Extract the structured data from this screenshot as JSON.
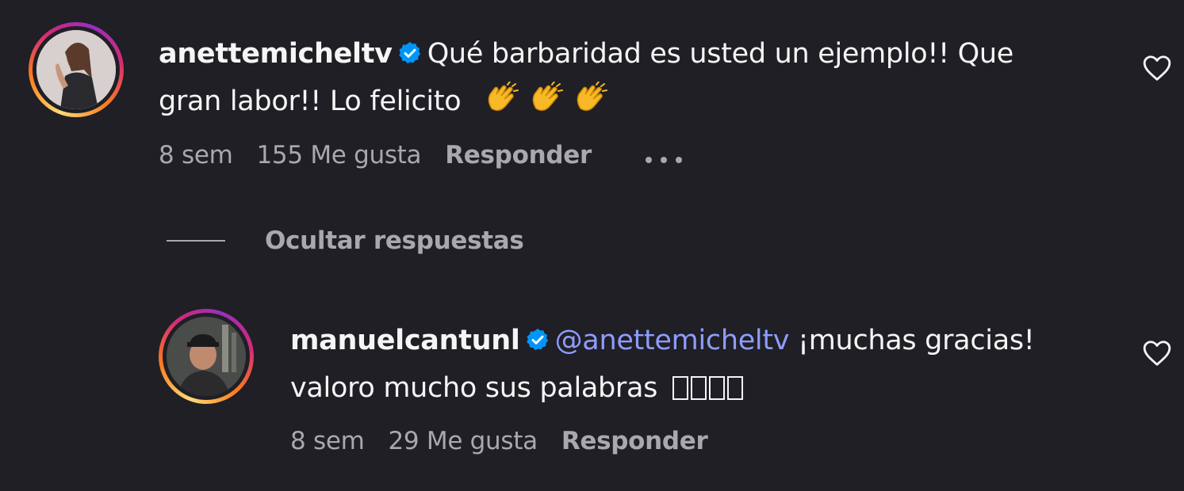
{
  "comments": [
    {
      "username": "anettemicheltv",
      "text_line1": "Qué barbaridad es usted un ejemplo!! Que",
      "text_line2": "gran labor!! Lo felicito",
      "time": "8 sem",
      "likes": "155 Me gusta",
      "reply_label": "Responder",
      "verified": true,
      "reaction_icons": [
        "clapping-hands-icon",
        "clapping-hands-icon",
        "clapping-hands-icon"
      ]
    },
    {
      "username": "manuelcantunl",
      "mention": "@anettemicheltv",
      "text_line1": "¡muchas gracias!",
      "text_line2": "valoro mucho sus palabras",
      "time": "8 sem",
      "likes": "29 Me gusta",
      "reply_label": "Responder",
      "verified": true
    }
  ],
  "thread": {
    "hide_replies_label": "Ocultar respuestas"
  },
  "colors": {
    "background": "#1f1f25",
    "text": "#f5f5f5",
    "muted": "#a8a8ad",
    "mention": "#8e9cff",
    "verified": "#0095f6"
  }
}
